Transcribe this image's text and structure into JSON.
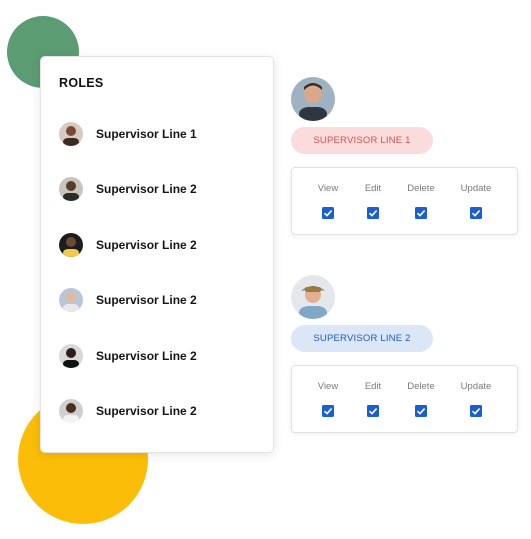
{
  "roles": {
    "title": "ROLES",
    "items": [
      {
        "label": "Supervisor Line 1"
      },
      {
        "label": "Supervisor Line 2"
      },
      {
        "label": "Supervisor Line 2"
      },
      {
        "label": "Supervisor Line 2"
      },
      {
        "label": "Supervisor Line 2"
      },
      {
        "label": "Supervisor Line 2"
      }
    ]
  },
  "permissions": [
    {
      "role_label": "SUPERVISOR LINE 1",
      "columns": [
        {
          "label": "View",
          "checked": true
        },
        {
          "label": "Edit",
          "checked": true
        },
        {
          "label": "Delete",
          "checked": true
        },
        {
          "label": "Update",
          "checked": true
        }
      ]
    },
    {
      "role_label": "SUPERVISOR LINE 2",
      "columns": [
        {
          "label": "View",
          "checked": true
        },
        {
          "label": "Edit",
          "checked": true
        },
        {
          "label": "Delete",
          "checked": true
        },
        {
          "label": "Update",
          "checked": true
        }
      ]
    }
  ],
  "colors": {
    "accent_blue": "#1a5fd0",
    "pill_red_bg": "#fbdcdc",
    "pill_red_text": "#d65050",
    "pill_blue_bg": "#dbe6f6",
    "pill_blue_text": "#1f5cc0",
    "blob_green": "#5c9c72",
    "blob_yellow": "#fbbd08"
  }
}
